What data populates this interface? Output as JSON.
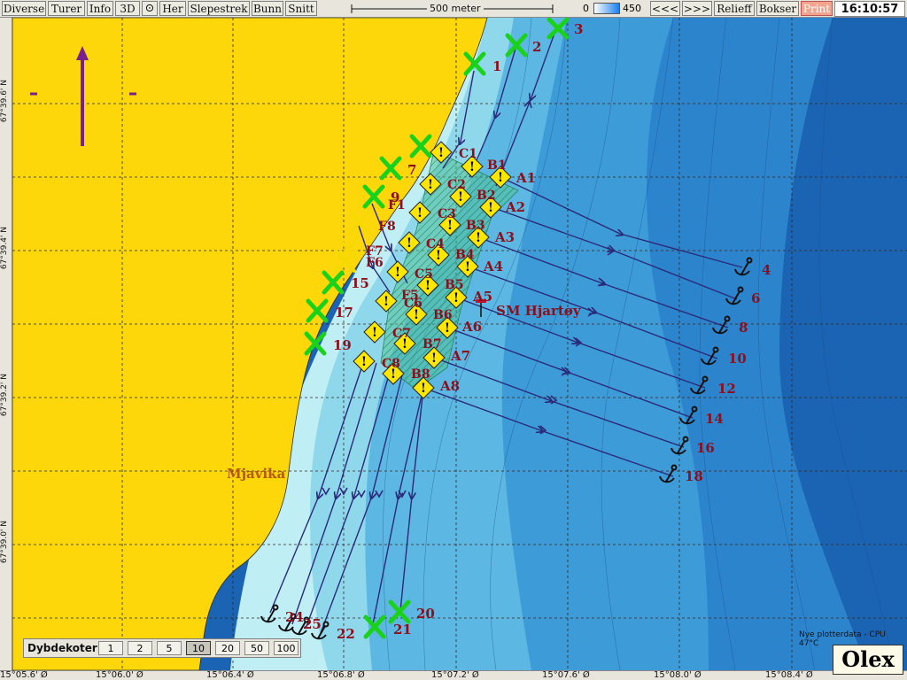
{
  "toolbar": {
    "buttons": [
      {
        "label": "Diverse"
      },
      {
        "label": "Turer"
      },
      {
        "label": "Info"
      },
      {
        "label": "3D"
      },
      {
        "label": "⊙"
      },
      {
        "label": "Her"
      },
      {
        "label": "Slepestrek"
      },
      {
        "label": "Bunn"
      },
      {
        "label": "Snitt"
      }
    ],
    "scale_label": "500 meter",
    "depth_min": "0",
    "depth_max": "450",
    "nav_back": "<<<",
    "nav_fwd": ">>>",
    "relieff": "Relieff",
    "bokser": "Bokser",
    "print": "Print",
    "clock": "16:10:57"
  },
  "map": {
    "place_name": "Mjavika",
    "feature_label": "SM Hjartøy",
    "plotter_info": "Nye plotterdata - CPU 47°C",
    "logo": "Olex",
    "longitude_ticks": [
      "15°05.6' Ø",
      "15°06.0' Ø",
      "15°06.4' Ø",
      "15°06.8' Ø",
      "15°07.2' Ø",
      "15°07.6' Ø",
      "15°08.0' Ø",
      "15°08.4' Ø"
    ],
    "latitude_ticks": [
      "67°39.6' N",
      "67°39.4' N",
      "67°39.2' N",
      "67°39.0' N"
    ],
    "x_markers": [
      "1",
      "2",
      "3",
      "7",
      "9",
      "15",
      "17",
      "19",
      "20",
      "21"
    ],
    "anchors": [
      "4",
      "6",
      "8",
      "10",
      "12",
      "14",
      "16",
      "18",
      "22",
      "24",
      "25"
    ],
    "warning_labels": [
      "A1",
      "A2",
      "A3",
      "A4",
      "A5",
      "A6",
      "A7",
      "A8",
      "B1",
      "B2",
      "B3",
      "B4",
      "B5",
      "B6",
      "B7",
      "B8",
      "C1",
      "C2",
      "C3",
      "C4",
      "C5",
      "C6",
      "C7",
      "C8",
      "F1",
      "F5",
      "F6",
      "F7",
      "F8"
    ]
  },
  "depth_panel": {
    "title": "Dybdekoter",
    "options": [
      "1",
      "2",
      "5",
      "10",
      "20",
      "50",
      "100"
    ],
    "selected": "10"
  }
}
